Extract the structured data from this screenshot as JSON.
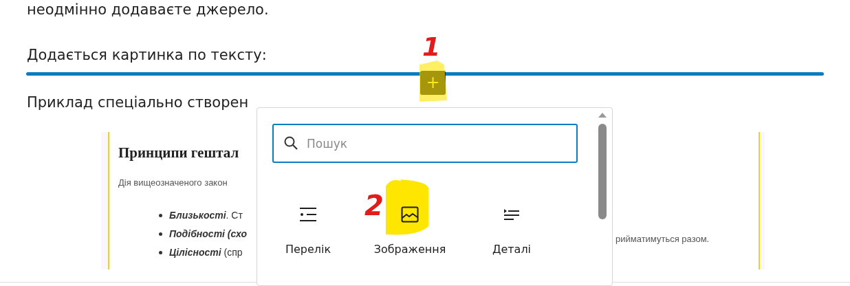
{
  "article": {
    "text_above": "неодмінно додаваєте джерело.",
    "intro": "Додається картинка по тексту:",
    "example": "Приклад спеціально створен"
  },
  "inserter_line": {
    "button": "+"
  },
  "embedded_document": {
    "heading": "Принципи гештал",
    "paragraph": "Дія вищеозначеного закон",
    "list": [
      {
        "emphasis": "Близькості",
        "rest": ". Ст"
      },
      {
        "emphasis": "Подібності (схо"
      },
      {
        "emphasis": "Цілісності",
        "rest": " (спр"
      }
    ],
    "fragment": "рийматимуться разом."
  },
  "block_inserter": {
    "search": {
      "placeholder": "Пошук"
    },
    "blocks": [
      {
        "label": "Перелік",
        "kind": "list"
      },
      {
        "label": "Зображення",
        "kind": "image"
      },
      {
        "label": "Деталі",
        "kind": "details"
      }
    ]
  },
  "annotations": [
    {
      "text": "1"
    },
    {
      "text": "2"
    }
  ]
}
